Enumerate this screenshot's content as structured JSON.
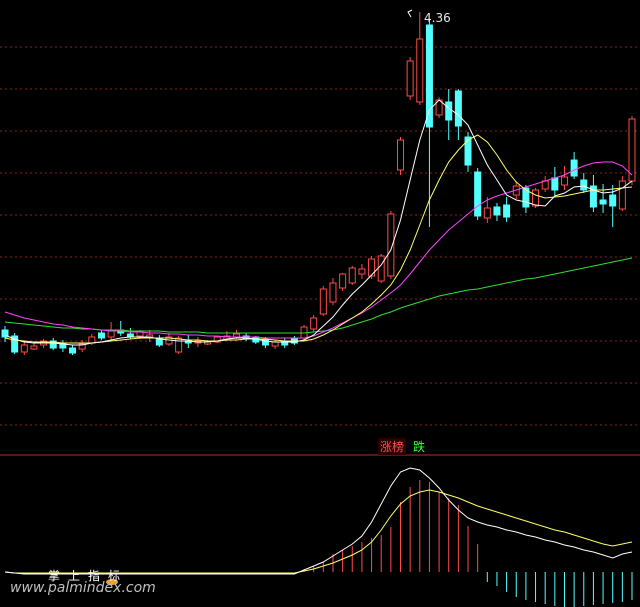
{
  "price_pane": {
    "high_marker": "4.36"
  },
  "indicator_pane": {
    "tab_rise": "涨榜",
    "tab_fall": "跌",
    "indicator_label": "掌上指标"
  },
  "watermark": "www.palmindex.com",
  "colors": {
    "background": "#000000",
    "up": "#ff4a4a",
    "down": "#54ffff",
    "ma_fast": "#ffffff",
    "ma_mid": "#ffff66",
    "ma_slow": "#ff44ff",
    "ma_long": "#33dd33",
    "grid": "#8a1f1f",
    "separator": "#b03030"
  },
  "chart_data": {
    "type": "candlestick",
    "candles": [
      {
        "o": 330,
        "c": 337,
        "h": 326,
        "l": 342
      },
      {
        "o": 336,
        "c": 352,
        "h": 333,
        "l": 354
      },
      {
        "o": 352,
        "c": 345,
        "h": 341,
        "l": 355
      },
      {
        "o": 349,
        "c": 346,
        "h": 342,
        "l": 350
      },
      {
        "o": 345,
        "c": 341,
        "h": 339,
        "l": 348
      },
      {
        "o": 341,
        "c": 348,
        "h": 338,
        "l": 350
      },
      {
        "o": 343,
        "c": 348,
        "h": 340,
        "l": 352
      },
      {
        "o": 348,
        "c": 353,
        "h": 345,
        "l": 355
      },
      {
        "o": 349,
        "c": 344,
        "h": 340,
        "l": 352
      },
      {
        "o": 343,
        "c": 337,
        "h": 334,
        "l": 345
      },
      {
        "o": 333,
        "c": 338,
        "h": 330,
        "l": 340
      },
      {
        "o": 337,
        "c": 331,
        "h": 322,
        "l": 340
      },
      {
        "o": 330,
        "c": 333,
        "h": 321,
        "l": 336
      },
      {
        "o": 334,
        "c": 337,
        "h": 328,
        "l": 339
      },
      {
        "o": 336,
        "c": 332,
        "h": 330,
        "l": 339
      },
      {
        "o": 337,
        "c": 335,
        "h": 330,
        "l": 342
      },
      {
        "o": 339,
        "c": 345,
        "h": 335,
        "l": 347
      },
      {
        "o": 344,
        "c": 337,
        "h": 333,
        "l": 346
      },
      {
        "o": 352,
        "c": 338,
        "h": 336,
        "l": 354
      },
      {
        "o": 341,
        "c": 343,
        "h": 335,
        "l": 348
      },
      {
        "o": 343,
        "c": 341,
        "h": 337,
        "l": 347
      },
      {
        "o": 344,
        "c": 341,
        "h": 340,
        "l": 345
      },
      {
        "o": 342,
        "c": 337,
        "h": 336,
        "l": 343
      },
      {
        "o": 340,
        "c": 336,
        "h": 331,
        "l": 341
      },
      {
        "o": 337,
        "c": 334,
        "h": 330,
        "l": 339
      },
      {
        "o": 336,
        "c": 339,
        "h": 333,
        "l": 341
      },
      {
        "o": 337,
        "c": 342,
        "h": 336,
        "l": 344
      },
      {
        "o": 340,
        "c": 345,
        "h": 337,
        "l": 348
      },
      {
        "o": 346,
        "c": 342,
        "h": 340,
        "l": 349
      },
      {
        "o": 341,
        "c": 345,
        "h": 338,
        "l": 348
      },
      {
        "o": 339,
        "c": 343,
        "h": 336,
        "l": 345
      },
      {
        "o": 338,
        "c": 327,
        "h": 325,
        "l": 340
      },
      {
        "o": 329,
        "c": 318,
        "h": 315,
        "l": 332
      },
      {
        "o": 314,
        "c": 289,
        "h": 286,
        "l": 316
      },
      {
        "o": 302,
        "c": 283,
        "h": 278,
        "l": 305
      },
      {
        "o": 288,
        "c": 274,
        "h": 273,
        "l": 291
      },
      {
        "o": 283,
        "c": 268,
        "h": 266,
        "l": 285
      },
      {
        "o": 274,
        "c": 269,
        "h": 264,
        "l": 279
      },
      {
        "o": 276,
        "c": 259,
        "h": 256,
        "l": 279
      },
      {
        "o": 281,
        "c": 256,
        "h": 254,
        "l": 283
      },
      {
        "o": 276,
        "c": 214,
        "h": 211,
        "l": 279
      },
      {
        "o": 170,
        "c": 140,
        "h": 137,
        "l": 175
      },
      {
        "o": 96,
        "c": 61,
        "h": 57,
        "l": 100
      },
      {
        "o": 102,
        "c": 39,
        "h": 12,
        "l": 105
      },
      {
        "o": 25,
        "c": 127,
        "h": 20,
        "l": 227
      },
      {
        "o": 115,
        "c": 100,
        "h": 97,
        "l": 118
      },
      {
        "o": 102,
        "c": 120,
        "h": 89,
        "l": 140
      },
      {
        "o": 91,
        "c": 126,
        "h": 89,
        "l": 140
      },
      {
        "o": 137,
        "c": 165,
        "h": 132,
        "l": 172
      },
      {
        "o": 172,
        "c": 216,
        "h": 168,
        "l": 220
      },
      {
        "o": 218,
        "c": 208,
        "h": 197,
        "l": 223
      },
      {
        "o": 207,
        "c": 215,
        "h": 203,
        "l": 221
      },
      {
        "o": 205,
        "c": 217,
        "h": 197,
        "l": 222
      },
      {
        "o": 195,
        "c": 186,
        "h": 181,
        "l": 199
      },
      {
        "o": 188,
        "c": 207,
        "h": 185,
        "l": 213
      },
      {
        "o": 206,
        "c": 190,
        "h": 188,
        "l": 208
      },
      {
        "o": 189,
        "c": 181,
        "h": 176,
        "l": 192
      },
      {
        "o": 178,
        "c": 190,
        "h": 167,
        "l": 196
      },
      {
        "o": 185,
        "c": 177,
        "h": 166,
        "l": 190
      },
      {
        "o": 160,
        "c": 176,
        "h": 152,
        "l": 179
      },
      {
        "o": 180,
        "c": 190,
        "h": 173,
        "l": 193
      },
      {
        "o": 186,
        "c": 207,
        "h": 175,
        "l": 212
      },
      {
        "o": 200,
        "c": 204,
        "h": 184,
        "l": 213
      },
      {
        "o": 195,
        "c": 206,
        "h": 185,
        "l": 227
      },
      {
        "o": 209,
        "c": 181,
        "h": 176,
        "l": 211
      },
      {
        "o": 181,
        "c": 119,
        "h": 116,
        "l": 185
      }
    ],
    "ma_fast": [
      335,
      339,
      342,
      343,
      343,
      343,
      344,
      345,
      345,
      343,
      342,
      340,
      338,
      337,
      337,
      337,
      339,
      340,
      341,
      341,
      342,
      342,
      341,
      339,
      338,
      338,
      339,
      341,
      342,
      342,
      342,
      340,
      335,
      326,
      317,
      305,
      294,
      285,
      275,
      265,
      250,
      220,
      180,
      140,
      110,
      100,
      108,
      115,
      125,
      145,
      165,
      180,
      195,
      200,
      202,
      205,
      206,
      196,
      193,
      187,
      186,
      190,
      193,
      192,
      188,
      181
    ],
    "ma_mid": [
      338,
      340,
      341,
      342,
      342,
      342,
      343,
      343,
      343,
      343,
      342,
      341,
      340,
      339,
      338,
      338,
      338,
      338,
      339,
      340,
      340,
      341,
      341,
      340,
      340,
      339,
      339,
      339,
      340,
      341,
      341,
      341,
      339,
      335,
      330,
      324,
      318,
      312,
      304,
      295,
      285,
      270,
      250,
      225,
      200,
      180,
      162,
      150,
      140,
      135,
      142,
      155,
      170,
      182,
      190,
      195,
      198,
      197,
      196,
      194,
      192,
      190,
      190,
      189,
      188,
      187
    ],
    "ma_slow": [
      312,
      315,
      318,
      320,
      322,
      324,
      325,
      327,
      328,
      329,
      330,
      331,
      331,
      332,
      332,
      333,
      333,
      334,
      334,
      335,
      335,
      336,
      336,
      337,
      337,
      337,
      337,
      338,
      338,
      338,
      338,
      338,
      336,
      332,
      328,
      323,
      318,
      313,
      307,
      300,
      293,
      285,
      274,
      262,
      250,
      240,
      230,
      222,
      214,
      206,
      200,
      196,
      193,
      190,
      187,
      184,
      181,
      178,
      175,
      170,
      166,
      163,
      162,
      162,
      166,
      175
    ],
    "ma_long": [
      322,
      323,
      324,
      325,
      326,
      327,
      328,
      328,
      329,
      329,
      330,
      330,
      330,
      331,
      331,
      331,
      331,
      332,
      332,
      332,
      332,
      333,
      333,
      333,
      333,
      333,
      333,
      333,
      333,
      333,
      333,
      333,
      332,
      331,
      330,
      328,
      325,
      322,
      319,
      315,
      312,
      308,
      305,
      302,
      299,
      296,
      294,
      292,
      290,
      289,
      287,
      285,
      283,
      281,
      279,
      278,
      276,
      274,
      272,
      270,
      268,
      266,
      264,
      262,
      260,
      258
    ],
    "indicator_bars": [
      0,
      0,
      0,
      0,
      0,
      0,
      0,
      0,
      0,
      0,
      0,
      0,
      0,
      0,
      0,
      0,
      0,
      0,
      0,
      0,
      0,
      0,
      0,
      0,
      0,
      0,
      0,
      0,
      0,
      0,
      0,
      3,
      6,
      10,
      18,
      22,
      26,
      30,
      34,
      37,
      45,
      70,
      85,
      92,
      90,
      80,
      74,
      67,
      46,
      28,
      -10,
      -14,
      -20,
      -25,
      -28,
      -30,
      -32,
      -34,
      -35,
      -36,
      -34,
      -33,
      -32,
      -31,
      -30,
      -28
    ],
    "indicator_line_a": [
      0,
      -1,
      -2,
      -2,
      -2,
      -2,
      -2,
      -2,
      -2,
      -2,
      -2,
      -2,
      -2,
      -2,
      -2,
      -2,
      -2,
      -2,
      -2,
      -2,
      -2,
      -2,
      -2,
      -2,
      -2,
      -2,
      -2,
      -2,
      -2,
      -2,
      -2,
      2,
      6,
      10,
      16,
      22,
      28,
      36,
      50,
      68,
      86,
      100,
      104,
      102,
      94,
      84,
      72,
      62,
      54,
      50,
      47,
      45,
      42,
      40,
      37,
      35,
      32,
      30,
      27,
      25,
      22,
      20,
      17,
      14,
      18,
      20
    ],
    "indicator_line_b": [
      0,
      -1,
      -1,
      -1,
      -1,
      -1,
      -1,
      -1,
      -1,
      -1,
      -1,
      -1,
      -1,
      -1,
      -1,
      -1,
      -1,
      -1,
      -1,
      -1,
      -1,
      -1,
      -1,
      -1,
      -1,
      -1,
      -1,
      -1,
      -1,
      -1,
      -1,
      1,
      3,
      6,
      9,
      13,
      17,
      22,
      30,
      42,
      56,
      68,
      76,
      80,
      82,
      80,
      77,
      74,
      70,
      66,
      63,
      60,
      57,
      54,
      51,
      48,
      45,
      42,
      40,
      37,
      34,
      31,
      28,
      26,
      28,
      30
    ]
  }
}
